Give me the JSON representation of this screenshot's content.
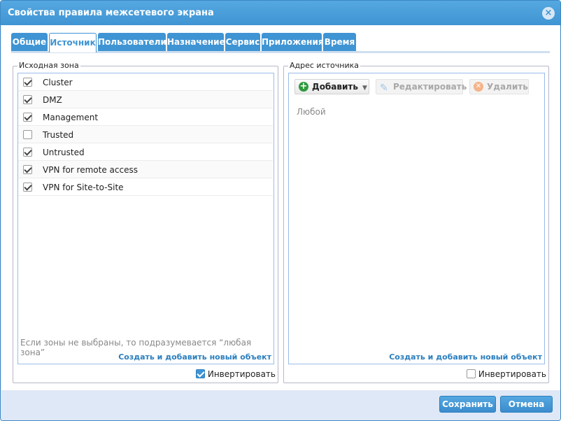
{
  "window": {
    "title": "Свойства правила межсетевого экрана",
    "close_label": "×"
  },
  "tabs": [
    {
      "label": "Общие",
      "active": false
    },
    {
      "label": "Источник",
      "active": true
    },
    {
      "label": "Пользователи",
      "active": false
    },
    {
      "label": "Назначение",
      "active": false
    },
    {
      "label": "Сервис",
      "active": false
    },
    {
      "label": "Приложения",
      "active": false
    },
    {
      "label": "Время",
      "active": false
    }
  ],
  "source_zone": {
    "legend": "Исходная зона",
    "zones": [
      {
        "label": "Cluster",
        "checked": true
      },
      {
        "label": "DMZ",
        "checked": true
      },
      {
        "label": "Management",
        "checked": true
      },
      {
        "label": "Trusted",
        "checked": false
      },
      {
        "label": "Untrusted",
        "checked": true
      },
      {
        "label": "VPN for remote access",
        "checked": true
      },
      {
        "label": "VPN for Site-to-Site",
        "checked": true
      }
    ],
    "hint": "Если зоны не выбраны, то подразумевается “любая зона”",
    "create_link": "Создать и добавить новый объект",
    "invert_label": "Инвертировать",
    "invert_checked": true
  },
  "source_address": {
    "legend": "Адрес источника",
    "add_button": "Добавить",
    "edit_button": "Редактировать",
    "delete_button": "Удалить",
    "any_text": "Любой",
    "create_link": "Создать и добавить новый объект",
    "invert_label": "Инвертировать",
    "invert_checked": false
  },
  "footer": {
    "save_label": "Сохранить",
    "cancel_label": "Отмена"
  },
  "colors": {
    "accent": "#3f94d3",
    "link": "#2a7ebe",
    "add_icon": "#2e9a3c"
  }
}
